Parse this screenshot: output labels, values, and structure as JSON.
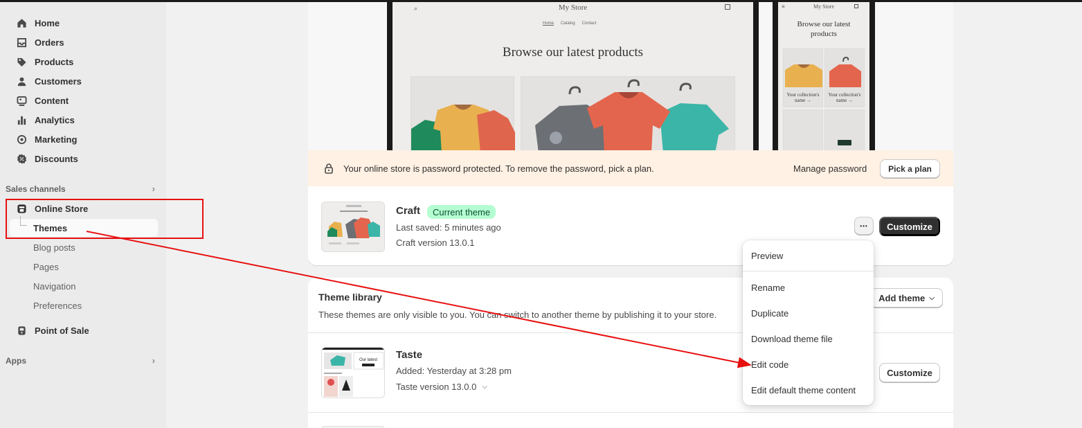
{
  "sidebar": {
    "items": [
      {
        "label": "Home",
        "icon": "home-icon"
      },
      {
        "label": "Orders",
        "icon": "inbox-icon"
      },
      {
        "label": "Products",
        "icon": "tag-icon"
      },
      {
        "label": "Customers",
        "icon": "person-icon"
      },
      {
        "label": "Content",
        "icon": "image-icon"
      },
      {
        "label": "Analytics",
        "icon": "bar-chart-icon"
      },
      {
        "label": "Marketing",
        "icon": "target-icon"
      },
      {
        "label": "Discounts",
        "icon": "discount-icon"
      }
    ],
    "sales_channels_label": "Sales channels",
    "online_store": {
      "label": "Online Store",
      "icon": "store-icon"
    },
    "online_store_sub": {
      "active": "Themes",
      "items": [
        "Blog posts",
        "Pages",
        "Navigation",
        "Preferences"
      ]
    },
    "pos": {
      "label": "Point of Sale",
      "icon": "pos-icon"
    },
    "apps_label": "Apps"
  },
  "preview": {
    "store_name": "My Store",
    "nav_links": [
      "Home",
      "Catalog",
      "Contact"
    ],
    "headline": "Browse our latest products",
    "mobile_headline": "Browse our latest products",
    "mobile_collection_label": "Your collection's name →"
  },
  "banner": {
    "message": "Your online store is password protected. To remove the password, pick a plan.",
    "manage_password": "Manage password",
    "pick_plan": "Pick a plan"
  },
  "current_theme": {
    "name": "Craft",
    "badge": "Current theme",
    "last_saved": "Last saved: 5 minutes ago",
    "version": "Craft version 13.0.1",
    "customize": "Customize",
    "more_label": "•••"
  },
  "menu": {
    "items": [
      "Preview",
      "Rename",
      "Duplicate",
      "Download theme file",
      "Edit code",
      "Edit default theme content"
    ]
  },
  "library": {
    "title": "Theme library",
    "description": "These themes are only visible to you. You can switch to another theme by publishing it to your store.",
    "add_theme": "Add theme",
    "themes": [
      {
        "name": "Taste",
        "added": "Added: Yesterday at 3:28 pm",
        "version": "Taste version 13.0.0",
        "customize": "Customize",
        "thumb_text": "Our latest"
      }
    ]
  },
  "colors": {
    "sidebar_bg": "#ebebeb",
    "banner_bg": "#fff1e3",
    "badge_bg": "#b4fed2",
    "annotation_red": "#e81010"
  }
}
